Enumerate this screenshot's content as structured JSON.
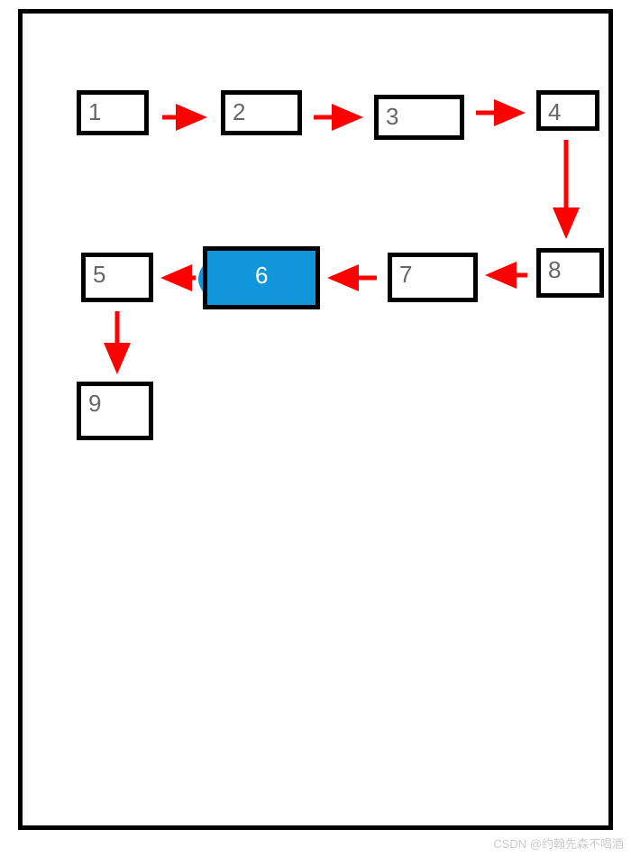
{
  "nodes": {
    "n1": "1",
    "n2": "2",
    "n3": "3",
    "n4": "4",
    "n5": "5",
    "n6": "6",
    "n7": "7",
    "n8": "8",
    "n9": "9"
  },
  "highlighted_node": "n6",
  "colors": {
    "arrow": "#ff0000",
    "node_border": "#000000",
    "highlight_fill": "#1296db",
    "text": "#666666",
    "highlight_text": "#ffffff"
  },
  "flow_sequence": [
    "n1",
    "n2",
    "n3",
    "n4",
    "n8",
    "n7",
    "n6",
    "n5",
    "n9"
  ],
  "arrows": [
    {
      "from": "n1",
      "to": "n2",
      "direction": "right"
    },
    {
      "from": "n2",
      "to": "n3",
      "direction": "right"
    },
    {
      "from": "n3",
      "to": "n4",
      "direction": "right"
    },
    {
      "from": "n4",
      "to": "n8",
      "direction": "down"
    },
    {
      "from": "n8",
      "to": "n7",
      "direction": "left"
    },
    {
      "from": "n7",
      "to": "n6",
      "direction": "left"
    },
    {
      "from": "n6",
      "to": "n5",
      "direction": "left"
    },
    {
      "from": "n5",
      "to": "n9",
      "direction": "down"
    }
  ],
  "watermark": "CSDN @约翰先森不喝酒"
}
